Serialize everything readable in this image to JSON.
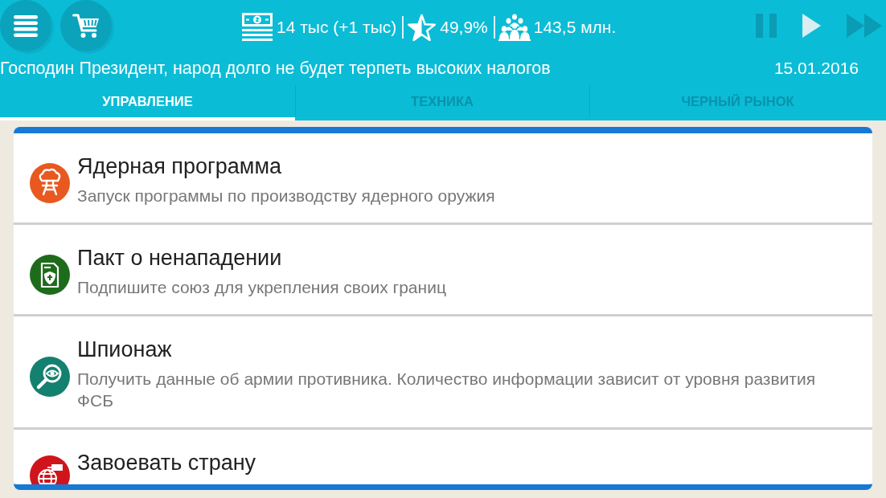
{
  "header": {
    "stats": [
      {
        "kind": "money",
        "value": "14 тыс (+1 тыс)"
      },
      {
        "kind": "rating",
        "value": "49,9%"
      },
      {
        "kind": "population",
        "value": "143,5 млн."
      }
    ],
    "speed_controls": [
      {
        "kind": "pause",
        "selected": false
      },
      {
        "kind": "play",
        "selected": true
      },
      {
        "kind": "fast_forward",
        "selected": false
      }
    ],
    "message": "Господин Президент, народ долго не будет терпеть высоких налогов",
    "date": "15.01.2016"
  },
  "tabs": [
    {
      "label": "УПРАВЛЕНИЕ",
      "selected": true
    },
    {
      "label": "ТЕХНИКА",
      "selected": false
    },
    {
      "label": "ЧЕРНЫЙ РЫНОК",
      "selected": false
    }
  ],
  "actions": [
    {
      "kind": "nuclear",
      "color": "#e8581f",
      "title": "Ядерная программа",
      "description": "Запуск программы по производству ядерного оружия"
    },
    {
      "kind": "pact",
      "color": "#1f6b1c",
      "title": "Пакт о ненападении",
      "description": "Подпишите союз для укрепления своих границ"
    },
    {
      "kind": "spy",
      "color": "#14806f",
      "title": "Шпионаж",
      "description": "Получить данные об армии противника. Количество информации зависит от уровня развития ФСБ"
    },
    {
      "kind": "conquest",
      "color": "#d0141c",
      "title": "Завоевать страну"
    }
  ]
}
